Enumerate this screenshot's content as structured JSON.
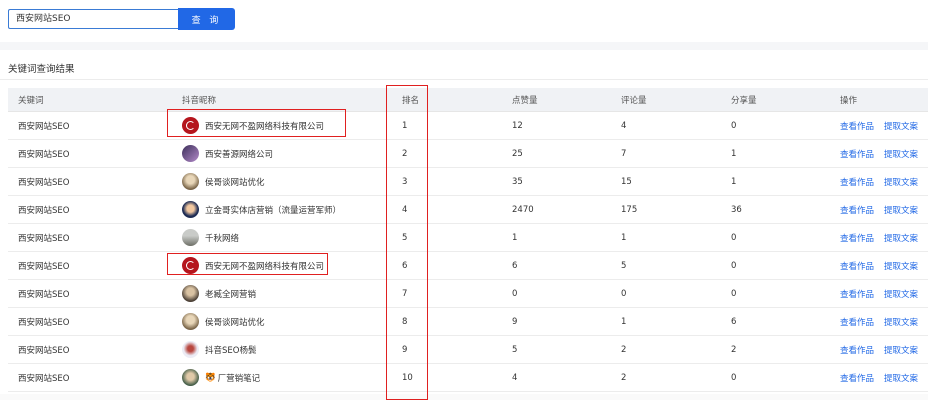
{
  "search": {
    "value": "西安网站SEO",
    "button_label": "查 询"
  },
  "section_title": "关键词查询结果",
  "table": {
    "headers": [
      "关键词",
      "抖音昵称",
      "排名",
      "点赞量",
      "评论量",
      "分享量",
      "操作"
    ],
    "actions": [
      "查看作品",
      "提取文案"
    ],
    "rows": [
      {
        "keyword": "西安网站SEO",
        "nickname": "西安无网不盈网络科技有限公司",
        "rank": "1",
        "likes": "12",
        "comments": "4",
        "shares": "0"
      },
      {
        "keyword": "西安网站SEO",
        "nickname": "西安善源网络公司",
        "rank": "2",
        "likes": "25",
        "comments": "7",
        "shares": "1"
      },
      {
        "keyword": "西安网站SEO",
        "nickname": "侯哥谈网站优化",
        "rank": "3",
        "likes": "35",
        "comments": "15",
        "shares": "1"
      },
      {
        "keyword": "西安网站SEO",
        "nickname": "立金哥实体店营销（流量运营军师）",
        "rank": "4",
        "likes": "2470",
        "comments": "175",
        "shares": "36"
      },
      {
        "keyword": "西安网站SEO",
        "nickname": "千秋网络",
        "rank": "5",
        "likes": "1",
        "comments": "1",
        "shares": "0"
      },
      {
        "keyword": "西安网站SEO",
        "nickname": "西安无网不盈网络科技有限公司",
        "rank": "6",
        "likes": "6",
        "comments": "5",
        "shares": "0"
      },
      {
        "keyword": "西安网站SEO",
        "nickname": "老臧全网营销",
        "rank": "7",
        "likes": "0",
        "comments": "0",
        "shares": "0"
      },
      {
        "keyword": "西安网站SEO",
        "nickname": "侯哥谈网站优化",
        "rank": "8",
        "likes": "9",
        "comments": "1",
        "shares": "6"
      },
      {
        "keyword": "西安网站SEO",
        "nickname": "抖音SEO杨鬓",
        "rank": "9",
        "likes": "5",
        "comments": "2",
        "shares": "2"
      },
      {
        "keyword": "西安网站SEO",
        "nickname": "厂营销笔记",
        "emoji": "🐯",
        "rank": "10",
        "likes": "4",
        "comments": "2",
        "shares": "0"
      }
    ]
  }
}
